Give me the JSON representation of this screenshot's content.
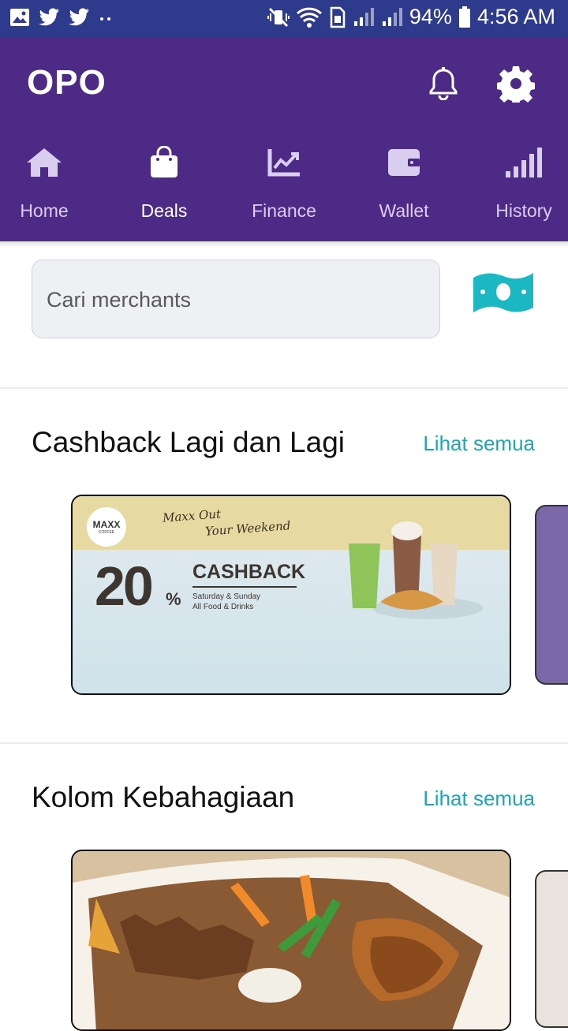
{
  "status_bar": {
    "battery": "94%",
    "time": "4:56 AM"
  },
  "header": {
    "title": "OPO",
    "tabs": [
      {
        "label": "Home",
        "icon": "home-icon"
      },
      {
        "label": "Deals",
        "icon": "shopping-bag-icon",
        "active": true
      },
      {
        "label": "Finance",
        "icon": "chart-icon"
      },
      {
        "label": "Wallet",
        "icon": "wallet-icon"
      },
      {
        "label": "History",
        "icon": "bars-icon"
      }
    ]
  },
  "search": {
    "placeholder": "Cari merchants"
  },
  "sections": [
    {
      "title": "Cashback Lagi dan Lagi",
      "see_all": "Lihat semua",
      "promo": {
        "brand": "MAXX",
        "brand_sub": "COFFEE",
        "slogan_line1": "Maxx Out",
        "slogan_line2": "Your Weekend",
        "percent": "20",
        "percent_sign": "%",
        "headline": "CASHBACK",
        "detail_line1": "Saturday & Sunday",
        "detail_line2": "All Food & Drinks"
      }
    },
    {
      "title": "Kolom Kebahagiaan",
      "see_all": "Lihat semua"
    }
  ],
  "colors": {
    "status_bar": "#2e3a8c",
    "header": "#4c2a86",
    "accent": "#1ba7b5",
    "money_icon": "#1bb7c2"
  }
}
